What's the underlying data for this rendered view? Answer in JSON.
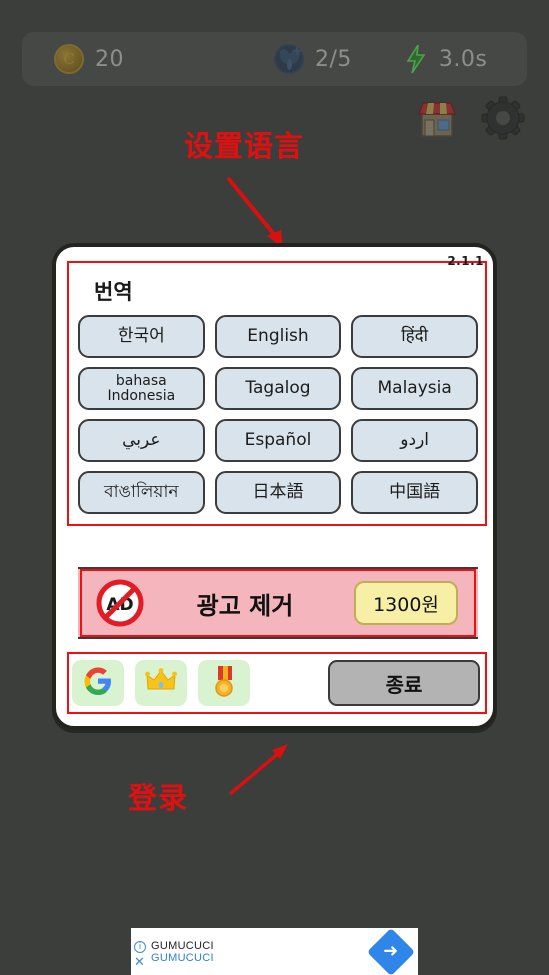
{
  "hud": {
    "coins": {
      "icon": "coin-icon",
      "value": "20"
    },
    "lives": {
      "icon": "fly-icon",
      "value": "2/5"
    },
    "timer": {
      "icon": "lightning-bolt-icon",
      "value": "3.0s"
    },
    "shop_icon": "shop-icon",
    "settings_icon": "gear-icon"
  },
  "annotations": [
    {
      "text": "设置语言",
      "color": "#e01010"
    },
    {
      "text": "登录",
      "color": "#e01010"
    }
  ],
  "dialog": {
    "title": "번역",
    "version": "2.1.1",
    "languages": [
      {
        "label": "한국어",
        "lines": 1
      },
      {
        "label": "English",
        "lines": 1
      },
      {
        "label": "हिंदी",
        "lines": 1
      },
      {
        "label": "bahasa\nIndonesia",
        "lines": 2
      },
      {
        "label": "Tagalog",
        "lines": 1
      },
      {
        "label": "Malaysia",
        "lines": 1
      },
      {
        "label": "عربي",
        "lines": 1
      },
      {
        "label": "Español",
        "lines": 1
      },
      {
        "label": "اردو",
        "lines": 1
      },
      {
        "label": "বাঙালিয়ান",
        "lines": 1
      },
      {
        "label": "日本語",
        "lines": 1
      },
      {
        "label": "中国語",
        "lines": 1
      }
    ],
    "ad_removal": {
      "icon": "no-ad-icon",
      "label": "광고 제거",
      "price": "1300원"
    },
    "bottom": {
      "social": [
        {
          "name": "google-signin",
          "icon": "google-g-icon"
        },
        {
          "name": "premium",
          "icon": "crown-icon"
        },
        {
          "name": "achievements",
          "icon": "medal-icon"
        }
      ],
      "exit_label": "종료"
    }
  },
  "bottom_ad": {
    "title": "GUMUCUCI",
    "subtitle": "GUMUCUCI",
    "info_icon": "info-icon",
    "close_icon": "close-icon",
    "cta_icon": "arrow-right-icon"
  },
  "colors": {
    "background": "#3b3e3b",
    "annotation_red": "#e01010",
    "lang_button": "#d9e3eb",
    "ad_bar": "#f4b6bc",
    "price_button": "#f6efa5",
    "social_button": "#d9f2cf",
    "exit_button": "#b3b3b3",
    "ad_cta_blue": "#2f86e8"
  }
}
